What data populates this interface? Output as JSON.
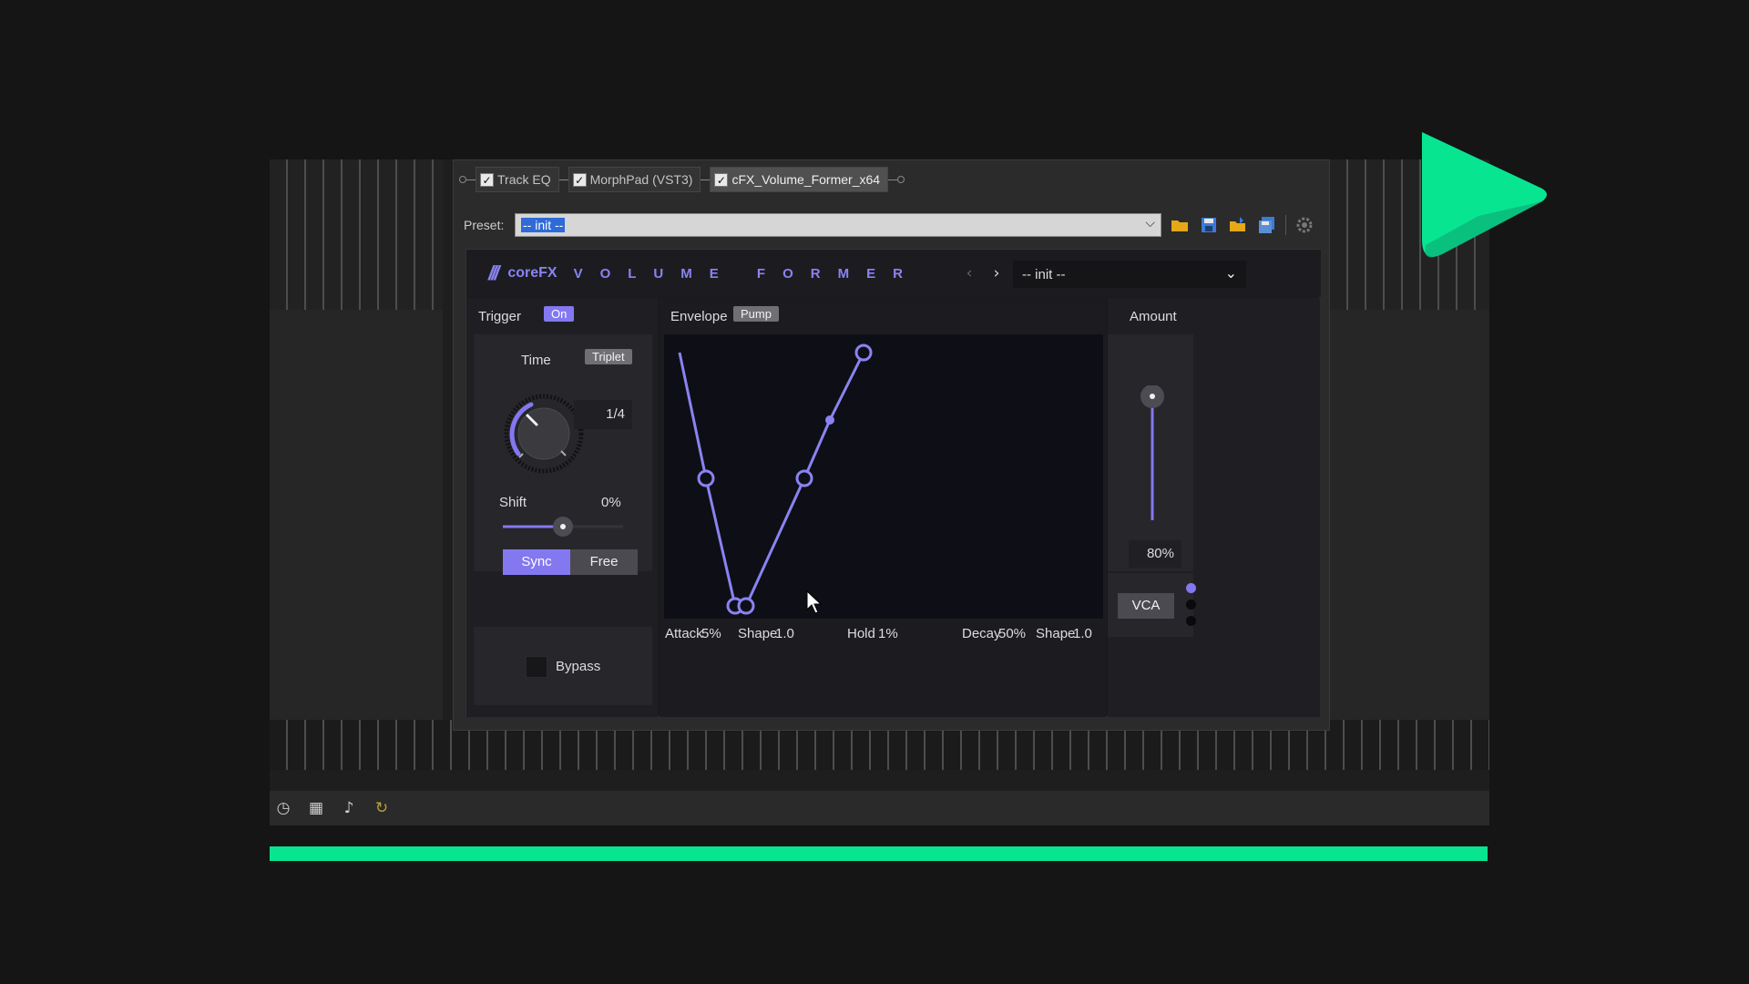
{
  "chain": {
    "slots": [
      {
        "label": "Track EQ"
      },
      {
        "label": "MorphPad (VST3)"
      },
      {
        "label": "cFX_Volume_Former_x64"
      }
    ]
  },
  "preset_bar": {
    "label": "Preset:",
    "value": "-- init --"
  },
  "plugin": {
    "logo_mark": "///",
    "brand": "coreFX",
    "product": "VOLUME FORMER",
    "preset": "-- init --"
  },
  "trigger": {
    "title": "Trigger",
    "toggle": "On",
    "time_label": "Time",
    "triplet": "Triplet",
    "time_value": "1/4",
    "shift_label": "Shift",
    "shift_value": "0%",
    "shift_level": 0.5,
    "sync": "Sync",
    "free": "Free",
    "bypass": "Bypass"
  },
  "envelope": {
    "title": "Envelope",
    "mode": "Pump",
    "params": {
      "attack_label": "Attack",
      "attack_value": "5%",
      "shape1_label": "Shape",
      "shape1_value": "1.0",
      "hold_label": "Hold",
      "hold_value": "1%",
      "decay_label": "Decay",
      "decay_value": "50%",
      "shape2_label": "Shape",
      "shape2_value": "1.0"
    }
  },
  "amount": {
    "title": "Amount",
    "value": "80%",
    "level": 0.8,
    "vca": "VCA"
  },
  "colors": {
    "accent": "#8378f0",
    "progress": "#08e591",
    "background": "#151515"
  }
}
